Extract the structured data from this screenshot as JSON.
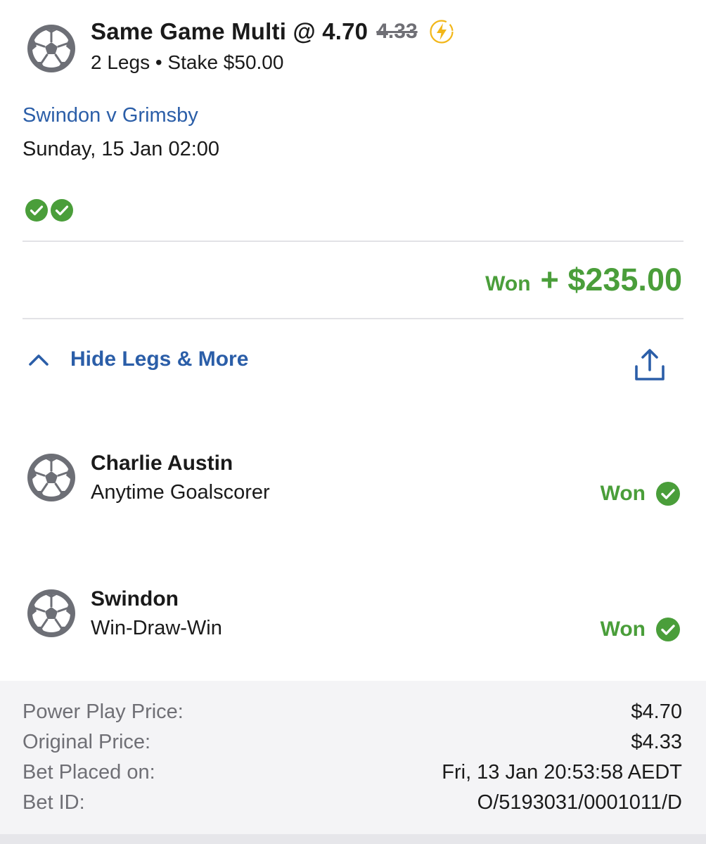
{
  "bet": {
    "title": "Same Game Multi @ 4.70",
    "original_price_struck": "4.33",
    "subtitle": "2 Legs • Stake $50.00",
    "event_link": "Swindon v Grimsby",
    "event_date": "Sunday, 15 Jan 02:00",
    "result_label": "Won",
    "result_amount": "+ $235.00",
    "toggle_label": "Hide Legs & More"
  },
  "legs": [
    {
      "name": "Charlie Austin",
      "market": "Anytime Goalscorer",
      "status": "Won"
    },
    {
      "name": "Swindon",
      "market": "Win-Draw-Win",
      "status": "Won"
    }
  ],
  "details": [
    {
      "label": "Power Play Price:",
      "value": "$4.70"
    },
    {
      "label": "Original Price:",
      "value": "$4.33"
    },
    {
      "label": "Bet Placed on:",
      "value": "Fri, 13 Jan 20:53:58 AEDT"
    },
    {
      "label": "Bet ID:",
      "value": "O/5193031/0001011/D"
    }
  ],
  "icons": {
    "sport": "soccer-ball-icon",
    "power_play": "lightning-bolt-icon",
    "leg_check": "check-circle-icon",
    "toggle": "chevron-up-icon",
    "share": "share-icon"
  },
  "colors": {
    "accent_blue": "#2b5ea8",
    "won_green": "#4a9e3a",
    "bolt_yellow": "#f2b618",
    "icon_grey": "#6d6f76"
  }
}
